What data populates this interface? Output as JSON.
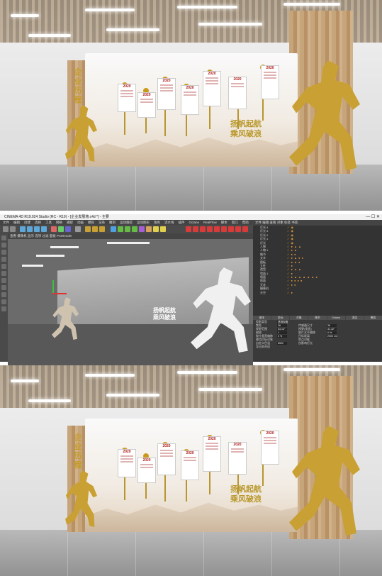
{
  "render": {
    "slogan_line1": "扬帆起航",
    "slogan_line2": "乘风破浪",
    "emblem_chars": [
      "企",
      "业",
      "历",
      "程"
    ],
    "timeline_cards": [
      {
        "year": "2020"
      },
      {
        "year": "2020"
      },
      {
        "year": "2020"
      },
      {
        "year": "2020"
      },
      {
        "year": "2020"
      },
      {
        "year": "2020"
      },
      {
        "year": "2020"
      },
      {
        "year": "2020"
      }
    ],
    "colors": {
      "gold": "#c9a033",
      "wood": "#c7a57b",
      "ceiling": "#6d5536"
    }
  },
  "c4d": {
    "title": "CINEMA 4D R19.024 Studio (RC - R19) - [企业发展墙.c4d *] - 主要",
    "layout_label": "界面: 启动",
    "menu": [
      "文件",
      "编辑",
      "创建",
      "选择",
      "工具",
      "网格",
      "捕捉",
      "动画",
      "模拟",
      "渲染",
      "雕刻",
      "运动跟踪",
      "运动图形",
      "角色",
      "流水线",
      "插件",
      "Octane",
      "RealFlow",
      "脚本",
      "窗口",
      "帮助"
    ],
    "viewport_menu": "查看  摄像机  显示  选项  过滤  面板  ProRender",
    "viewport_info": "网格间距 : 1000 cm",
    "object_panel_header": "文件  编辑  查看  对象  标签  书签",
    "objects": [
      {
        "name": "灯光.4",
        "tags": "✓ ◉"
      },
      {
        "name": "灯光.3",
        "tags": "✓ ◉"
      },
      {
        "name": "灯光.2",
        "tags": "✓ ◉"
      },
      {
        "name": "灯光.1",
        "tags": "✓ ◉"
      },
      {
        "name": "灯光",
        "tags": "✓ ◉"
      },
      {
        "name": "人物",
        "tags": "✓ ● ▲ ▲"
      },
      {
        "name": "人物.1",
        "tags": "✓ ● ▲"
      },
      {
        "name": "细节",
        "tags": "✓ ● ●"
      },
      {
        "name": "文字",
        "tags": "✓ ● ▲ ● ●"
      },
      {
        "name": "图板",
        "tags": "✓ ● ▲ ●"
      },
      {
        "name": "立柱",
        "tags": "✓ ●"
      },
      {
        "name": "造型",
        "tags": "✓ ● ▲ ▲"
      },
      {
        "name": "墙面.1",
        "tags": "✓ ●"
      },
      {
        "name": "墙面",
        "tags": "✓ ● ▲ ▲ ▲ ▲ ▲ ●"
      },
      {
        "name": "地面",
        "tags": "✓ ● ● ● ●"
      },
      {
        "name": "天花",
        "tags": "✓ ● ●"
      },
      {
        "name": "摄像机",
        "tags": "✓"
      },
      {
        "name": "天空",
        "tags": "✓ ●"
      }
    ],
    "attr_tabs": [
      "基本",
      "坐标",
      "对象",
      "细节",
      "Octane",
      "渲染",
      "模拟"
    ],
    "attr_rows": [
      {
        "label": "投影类型",
        "value": "透视视图",
        "label2": "",
        "value2": ""
      },
      {
        "label": "焦距",
        "value": "36",
        "label2": "传感器尺寸",
        "value2": "36"
      },
      {
        "label": "视野范围",
        "value": "53.13°",
        "label2": "视野(垂直)",
        "value2": "31.42°"
      },
      {
        "label": "缩放",
        "value": "1",
        "label2": "胶片水平偏移",
        "value2": "0 %"
      },
      {
        "label": "胶片垂直偏移",
        "value": "0 %",
        "label2": "目标距离",
        "value2": "2000 cm"
      },
      {
        "label": "使用目标对象",
        "value": "",
        "label2": "焦点对象",
        "value2": ""
      },
      {
        "label": "自定义色温",
        "value": "6500",
        "label2": "仅影响灯光",
        "value2": ""
      },
      {
        "label": "导出到合成",
        "value": "",
        "label2": "",
        "value2": ""
      }
    ],
    "coords": [
      {
        "label": "X",
        "value": "-1975.214 cm",
        "value2": "0 cm"
      },
      {
        "label": "Y",
        "value": "121.563 cm",
        "value2": "0 cm"
      },
      {
        "label": "Z",
        "value": "-3281.547 cm",
        "value2": "0 cm"
      }
    ],
    "coord_buttons": [
      "对象(相对)",
      "绝对尺寸",
      "应用"
    ],
    "frame_start": "0 F",
    "frame_end": "90 F",
    "material_header": "创建  编辑  功能  纹理",
    "status": "移动: 点击并拖动鼠标移动元素。按住 SHIFT 键量化移动; 节点编辑模式时按住 SHIFT 键增加选择对象; 按住 CTRL 键减少选择对象。",
    "materials": [
      "#2a2a2a",
      "#9a9a9a",
      "#d0d0d0",
      "#f0f0f0",
      "#7a7a7a",
      "#b5b5b5",
      "#6d4a2a",
      "#4a2e18",
      "#8c5a30",
      "#e6e6e6",
      "#a0a0a0",
      "#c8c8c8",
      "#555555",
      "#ececec",
      "#3c3c3c",
      "#b0b0b0"
    ]
  }
}
